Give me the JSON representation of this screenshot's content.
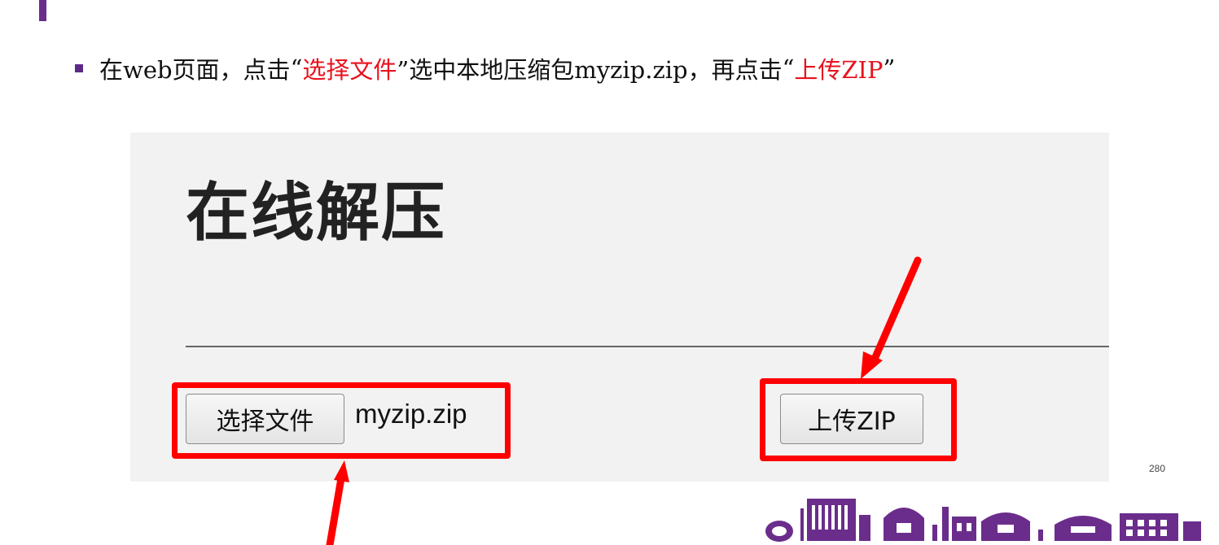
{
  "slide": {
    "bullet": {
      "prefix": "在web页面，点击",
      "open_quote_1": "“",
      "highlight_1": "选择文件",
      "mid": "”选中本地压缩包myzip.zip，再点击",
      "open_quote_2": "“",
      "highlight_2": "上传ZIP",
      "close_quote_2": "”"
    },
    "page_number": "280"
  },
  "screenshot": {
    "title": "在线解压",
    "file_button_label": "选择文件",
    "selected_file": "myzip.zip",
    "upload_button_label": "上传ZIP"
  },
  "colors": {
    "accent": "#6b2d8b",
    "highlight_red": "#ff0000",
    "screenshot_background": "#f2f2f2",
    "skyline_purple": "#6b2d8b"
  }
}
